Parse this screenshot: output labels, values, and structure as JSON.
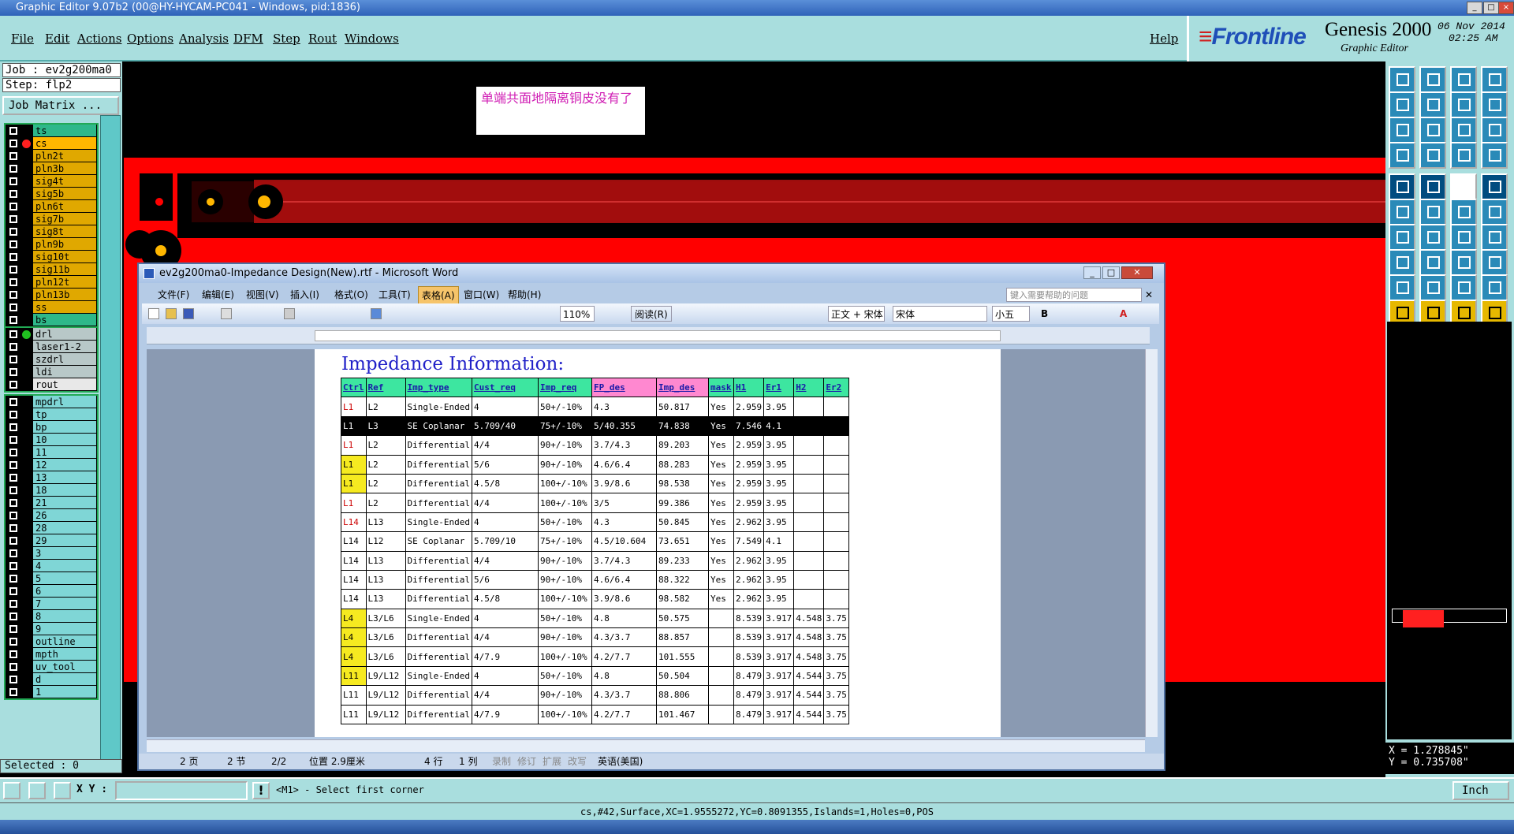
{
  "window": {
    "title": "Graphic Editor 9.07b2 (00@HY-HYCAM-PC041 - Windows, pid:1836)"
  },
  "menu": {
    "items": [
      "File",
      "Edit",
      "Actions",
      "Options",
      "Analysis",
      "DFM",
      "Step",
      "Rout",
      "Windows"
    ],
    "help": "Help"
  },
  "brand": {
    "logo": "Frontline",
    "product": "Genesis 2000",
    "sub": "Graphic Editor",
    "date": "06 Nov 2014",
    "time": "02:25 AM"
  },
  "job": {
    "job_line": "Job : ev2g200ma0",
    "step_line": "Step: flp2",
    "matrix_button": "Job Matrix ..."
  },
  "layers_board": [
    {
      "name": "ts",
      "color": "#2eb88a"
    },
    {
      "name": "cs",
      "color": "#ffb700",
      "active": true
    },
    {
      "name": "pln2t",
      "color": "#e0a800"
    },
    {
      "name": "pln3b",
      "color": "#e0a800"
    },
    {
      "name": "sig4t",
      "color": "#e0a800"
    },
    {
      "name": "sig5b",
      "color": "#e0a800"
    },
    {
      "name": "pln6t",
      "color": "#e0a800"
    },
    {
      "name": "sig7b",
      "color": "#e0a800"
    },
    {
      "name": "sig8t",
      "color": "#e0a800"
    },
    {
      "name": "pln9b",
      "color": "#e0a800"
    },
    {
      "name": "sig10t",
      "color": "#e0a800"
    },
    {
      "name": "sig11b",
      "color": "#e0a800"
    },
    {
      "name": "pln12t",
      "color": "#e0a800"
    },
    {
      "name": "pln13b",
      "color": "#e0a800"
    },
    {
      "name": "ss",
      "color": "#e0a800"
    },
    {
      "name": "bs",
      "color": "#2eb88a"
    }
  ],
  "layers_drill": [
    {
      "name": "drl",
      "color": "#b8c8c8"
    },
    {
      "name": "laser1-2",
      "color": "#b8c8c8"
    },
    {
      "name": "szdrl",
      "color": "#b8c8c8"
    },
    {
      "name": "ldi",
      "color": "#b8c8c8"
    },
    {
      "name": "rout",
      "color": "#e8e8e8"
    }
  ],
  "layers_misc": [
    "mpdrl",
    "tp",
    "bp",
    "10",
    "11",
    "12",
    "13",
    "18",
    "21",
    "26",
    "28",
    "29",
    "3",
    "4",
    "5",
    "6",
    "7",
    "8",
    "9",
    "outline",
    "mpth",
    "uv_tool",
    "d",
    "1"
  ],
  "selected": "Selected : 0",
  "note": "单端共面地隔离铜皮没有了",
  "coords": {
    "x": "X = 1.278845\"",
    "y": "Y = 0.735708\""
  },
  "bottom": {
    "xy_label": "X Y :",
    "prompt": "<M1> - Select first corner",
    "units": "Inch"
  },
  "status": "cs,#42,Surface,XC=1.9555272,YC=0.8091355,Islands=1,Holes=0,POS",
  "word": {
    "title": "ev2g200ma0-Impedance Design(New).rtf - Microsoft Word",
    "menu": [
      "文件(F)",
      "编辑(E)",
      "视图(V)",
      "插入(I)",
      "格式(O)",
      "工具(T)",
      "表格(A)",
      "窗口(W)",
      "帮助(H)"
    ],
    "help_placeholder": "键入需要帮助的问题",
    "zoom": "110%",
    "read_mode": "阅读(R)",
    "style": "正文 + 宋体",
    "font": "宋体",
    "size": "小五",
    "doc_title": "Impedance Information:",
    "headers": [
      "Ctrl",
      "Ref",
      "Imp_type",
      "Cust_req",
      "Imp_req",
      "FP_des",
      "Imp_des",
      "mask",
      "H1",
      "Er1",
      "H2",
      "Er2"
    ],
    "rows": [
      [
        "L1",
        "L2",
        "Single-Ended",
        "4",
        "50+/-10%",
        "4.3",
        "50.817",
        "Yes",
        "2.959",
        "3.95",
        "",
        ""
      ],
      [
        "L1",
        "L3",
        "SE Coplanar",
        "5.709/40",
        "75+/-10%",
        "5/40.355",
        "74.838",
        "Yes",
        "7.546",
        "4.1",
        "",
        ""
      ],
      [
        "L1",
        "L2",
        "Differential",
        "4/4",
        "90+/-10%",
        "3.7/4.3",
        "89.203",
        "Yes",
        "2.959",
        "3.95",
        "",
        ""
      ],
      [
        "L1",
        "L2",
        "Differential",
        "5/6",
        "90+/-10%",
        "4.6/6.4",
        "88.283",
        "Yes",
        "2.959",
        "3.95",
        "",
        ""
      ],
      [
        "L1",
        "L2",
        "Differential",
        "4.5/8",
        "100+/-10%",
        "3.9/8.6",
        "98.538",
        "Yes",
        "2.959",
        "3.95",
        "",
        ""
      ],
      [
        "L1",
        "L2",
        "Differential",
        "4/4",
        "100+/-10%",
        "3/5",
        "99.386",
        "Yes",
        "2.959",
        "3.95",
        "",
        ""
      ],
      [
        "L14",
        "L13",
        "Single-Ended",
        "4",
        "50+/-10%",
        "4.3",
        "50.845",
        "Yes",
        "2.962",
        "3.95",
        "",
        ""
      ],
      [
        "L14",
        "L12",
        "SE Coplanar",
        "5.709/10",
        "75+/-10%",
        "4.5/10.604",
        "73.651",
        "Yes",
        "7.549",
        "4.1",
        "",
        ""
      ],
      [
        "L14",
        "L13",
        "Differential",
        "4/4",
        "90+/-10%",
        "3.7/4.3",
        "89.233",
        "Yes",
        "2.962",
        "3.95",
        "",
        ""
      ],
      [
        "L14",
        "L13",
        "Differential",
        "5/6",
        "90+/-10%",
        "4.6/6.4",
        "88.322",
        "Yes",
        "2.962",
        "3.95",
        "",
        ""
      ],
      [
        "L14",
        "L13",
        "Differential",
        "4.5/8",
        "100+/-10%",
        "3.9/8.6",
        "98.582",
        "Yes",
        "2.962",
        "3.95",
        "",
        ""
      ],
      [
        "L4",
        "L3/L6",
        "Single-Ended",
        "4",
        "50+/-10%",
        "4.8",
        "50.575",
        "",
        "8.539",
        "3.917",
        "4.548",
        "3.75"
      ],
      [
        "L4",
        "L3/L6",
        "Differential",
        "4/4",
        "90+/-10%",
        "4.3/3.7",
        "88.857",
        "",
        "8.539",
        "3.917",
        "4.548",
        "3.75"
      ],
      [
        "L4",
        "L3/L6",
        "Differential",
        "4/7.9",
        "100+/-10%",
        "4.2/7.7",
        "101.555",
        "",
        "8.539",
        "3.917",
        "4.548",
        "3.75"
      ],
      [
        "L11",
        "L9/L12",
        "Single-Ended",
        "4",
        "50+/-10%",
        "4.8",
        "50.504",
        "",
        "8.479",
        "3.917",
        "4.544",
        "3.75"
      ],
      [
        "L11",
        "L9/L12",
        "Differential",
        "4/4",
        "90+/-10%",
        "4.3/3.7",
        "88.806",
        "",
        "8.479",
        "3.917",
        "4.544",
        "3.75"
      ],
      [
        "L11",
        "L9/L12",
        "Differential",
        "4/7.9",
        "100+/-10%",
        "4.2/7.7",
        "101.467",
        "",
        "8.479",
        "3.917",
        "4.544",
        "3.75"
      ]
    ],
    "status": [
      "2 页",
      "2 节",
      "2/2",
      "位置 2.9厘米",
      "4 行",
      "1 列",
      "录制",
      "修订",
      "扩展",
      "改写",
      "英语(美国)"
    ]
  }
}
